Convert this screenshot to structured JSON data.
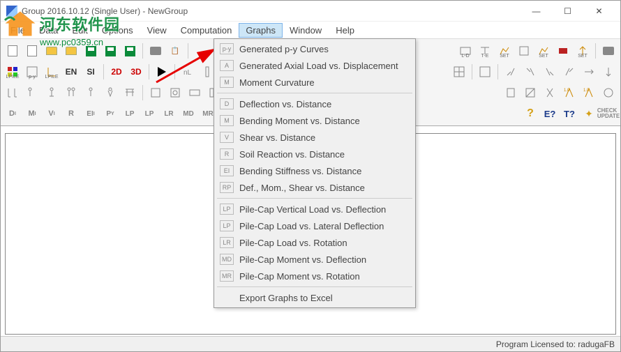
{
  "window": {
    "title": "Group 2016.10.12 (Single User) - NewGroup"
  },
  "menubar": {
    "items": [
      "File",
      "Data",
      "Edit",
      "Options",
      "View",
      "Computation",
      "Graphs",
      "Window",
      "Help"
    ],
    "active_index": 6
  },
  "dropdown": {
    "groups": [
      [
        {
          "icon": "p-y",
          "label": "Generated p-y Curves"
        },
        {
          "icon": "A",
          "label": "Generated Axial Load vs. Displacement"
        },
        {
          "icon": "M",
          "label": "Moment Curvature"
        }
      ],
      [
        {
          "icon": "D",
          "label": "Deflection vs. Distance"
        },
        {
          "icon": "M",
          "label": "Bending Moment vs. Distance"
        },
        {
          "icon": "V",
          "label": "Shear vs. Distance"
        },
        {
          "icon": "R",
          "label": "Soil Reaction vs. Distance"
        },
        {
          "icon": "EI",
          "label": "Bending Stiffness vs. Distance"
        },
        {
          "icon": "RP",
          "label": "Def., Mom., Shear vs. Distance"
        }
      ],
      [
        {
          "icon": "LP",
          "label": "Pile-Cap Vertical Load vs. Deflection"
        },
        {
          "icon": "LP",
          "label": "Pile-Cap Load vs. Lateral Deflection"
        },
        {
          "icon": "LR",
          "label": "Pile-Cap Load vs. Rotation"
        },
        {
          "icon": "MD",
          "label": "Pile-Cap Moment vs. Deflection"
        },
        {
          "icon": "MR",
          "label": "Pile-Cap Moment vs. Rotation"
        }
      ],
      [
        {
          "icon": "",
          "label": "Export Graphs to Excel"
        }
      ]
    ]
  },
  "toolbars": {
    "row1": [
      "new",
      "new2",
      "open",
      "open2",
      "save",
      "save2",
      "saveas",
      "sep",
      "print",
      "copy",
      "sep"
    ],
    "row2_left": [
      "lpile",
      "py",
      "lpile2",
      "EN",
      "SI",
      "sep",
      "2D",
      "3D",
      "sep",
      "play",
      "sep",
      "nl",
      "pile",
      "ft",
      "bar",
      "bar2"
    ],
    "row2_right": [
      "ld",
      "te",
      "set",
      "lc",
      "set2",
      "rect",
      "set3",
      "sep",
      "print2"
    ],
    "row3_left": [
      "b1",
      "b2",
      "b3",
      "b4",
      "b5",
      "b6",
      "b7",
      "sep",
      "b8",
      "b9",
      "b10",
      "b11",
      "sep",
      "b12",
      "b13",
      "b14",
      "b15"
    ],
    "row3_right": [
      "e1",
      "e2",
      "e3",
      "e4",
      "sep",
      "e5",
      "e6"
    ],
    "row4_left": [
      "D",
      "M",
      "V",
      "R",
      "EI",
      "PY",
      "LP",
      "LP",
      "LR",
      "MD",
      "MR",
      "sep",
      "g1",
      "g2"
    ],
    "row4_right": [
      "q",
      "E?",
      "T?",
      "puz",
      "update"
    ]
  },
  "statusbar": {
    "text": "Program Licensed to: radugaFB"
  },
  "watermark": {
    "text": "河东软件园",
    "url": "www.pc0359.cn"
  }
}
